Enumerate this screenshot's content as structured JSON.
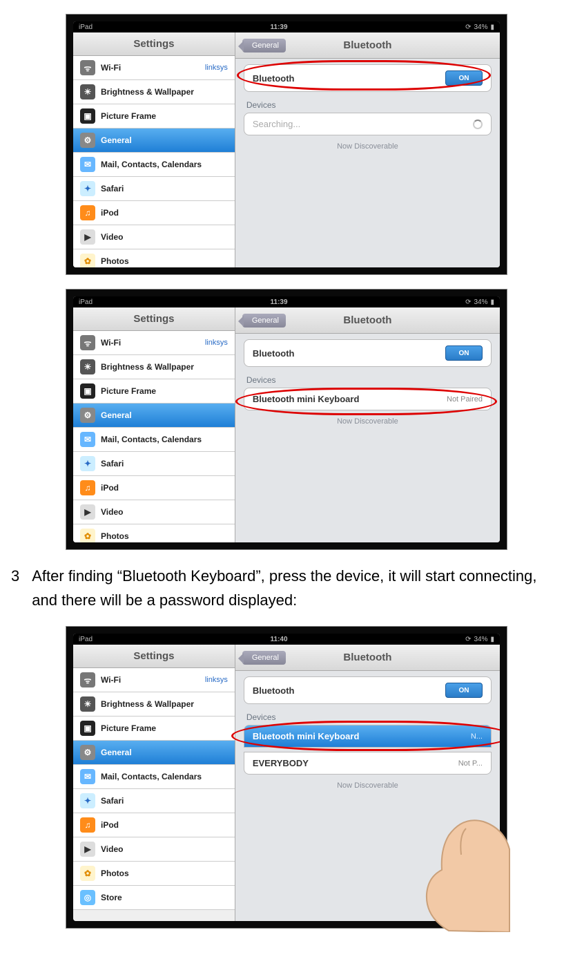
{
  "status": {
    "device": "iPad",
    "time1": "11:39",
    "time2": "11:39",
    "time3": "11:40",
    "battery": "34%"
  },
  "sidebar": {
    "title": "Settings",
    "items": [
      {
        "label": "Wi-Fi",
        "detail": "linksys",
        "icon": "wifi"
      },
      {
        "label": "Brightness & Wallpaper",
        "icon": "brightness"
      },
      {
        "label": "Picture Frame",
        "icon": "picture"
      },
      {
        "label": "General",
        "icon": "general",
        "selected": true
      },
      {
        "label": "Mail, Contacts, Calendars",
        "icon": "mail"
      },
      {
        "label": "Safari",
        "icon": "safari"
      },
      {
        "label": "iPod",
        "icon": "ipod"
      },
      {
        "label": "Video",
        "icon": "video"
      },
      {
        "label": "Photos",
        "icon": "photos"
      },
      {
        "label": "Store",
        "icon": "store"
      }
    ]
  },
  "main": {
    "back": "General",
    "title": "Bluetooth",
    "bluetooth_label": "Bluetooth",
    "toggle": "ON",
    "devices_label": "Devices",
    "searching": "Searching...",
    "discoverable": "Now Discoverable",
    "device1": {
      "name": "Bluetooth mini Keyboard",
      "status": "Not Paired"
    },
    "device2": {
      "name": "Bluetooth mini Keyboard",
      "status": "N..."
    },
    "device3": {
      "name": "EVERYBODY",
      "status": "Not P..."
    }
  },
  "instruction": {
    "num": "3",
    "text": "After finding “Bluetooth Keyboard”, press the device, it will start connecting, and there will be a password displayed:"
  }
}
